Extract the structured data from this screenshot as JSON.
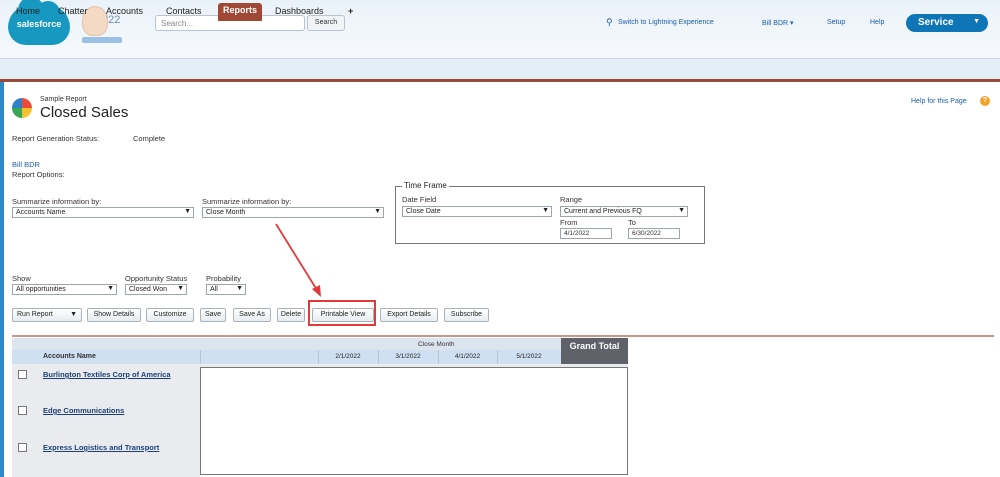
{
  "header": {
    "logo_text": "salesforce",
    "mascot_year": "'22",
    "search_placeholder": "Search...",
    "search_button": "Search",
    "switch_link": "Switch to Lightning Experience",
    "user_menu": "Bill BDR",
    "setup_link": "Setup",
    "help_link": "Help",
    "app_button": "Service"
  },
  "tabs": [
    {
      "label": "Home"
    },
    {
      "label": "Chatter"
    },
    {
      "label": "Accounts"
    },
    {
      "label": "Contacts"
    },
    {
      "label": "Reports"
    },
    {
      "label": "Dashboards"
    },
    {
      "label": "+"
    }
  ],
  "report": {
    "subtitle": "Sample Report",
    "title": "Closed Sales",
    "help_page_link": "Help for this Page",
    "status_label": "Report Generation Status:",
    "status_value": "Complete",
    "owner_link": "Bill BDR",
    "options_label": "Report Options:"
  },
  "options": {
    "summarize1_label": "Summarize information by:",
    "summarize1_value": "Accounts Name",
    "summarize2_label": "Summarize information by:",
    "summarize2_value": "Close Month",
    "timeframe_legend": "Time Frame",
    "date_field_label": "Date Field",
    "date_field_value": "Close Date",
    "range_label": "Range",
    "range_value": "Current and Previous FQ",
    "from_label": "From",
    "from_value": "4/1/2022",
    "to_label": "To",
    "to_value": "6/30/2022",
    "show_label": "Show",
    "show_value": "All opportunities",
    "opp_status_label": "Opportunity Status",
    "opp_status_value": "Closed Won",
    "probability_label": "Probability",
    "probability_value": "All"
  },
  "buttons": {
    "run_report": "Run Report",
    "show_details": "Show Details",
    "customize": "Customize",
    "save": "Save",
    "save_as": "Save As",
    "delete": "Delete",
    "printable_view": "Printable View",
    "export_details": "Export Details",
    "subscribe": "Subscribe"
  },
  "table": {
    "group_header": "Close Month",
    "grand_total": "Grand Total",
    "account_header": "Accounts Name",
    "months": [
      "2/1/2022",
      "3/1/2022",
      "4/1/2022",
      "5/1/2022"
    ],
    "rows": [
      {
        "account": "Burlington Textiles Corp of America"
      },
      {
        "account": "Edge Communications"
      },
      {
        "account": "Express Logistics and Transport"
      }
    ]
  },
  "colors": {
    "brand_blue": "#1798c1",
    "active_tab": "#a14736",
    "highlight": "#e23a3a"
  }
}
